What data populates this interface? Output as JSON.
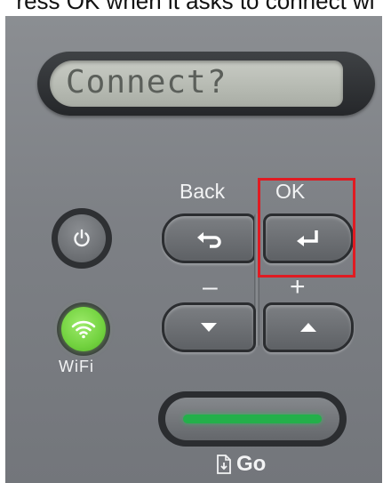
{
  "caption": "ress OK when it asks to connect wi",
  "lcd": {
    "text": "Connect?"
  },
  "labels": {
    "back": "Back",
    "ok": "OK",
    "minus": "–",
    "plus": "+",
    "wifi": "WiFi",
    "go": "Go"
  },
  "icons": {
    "power": "power-icon",
    "back": "back-arrow-icon",
    "ok": "enter-arrow-icon",
    "down": "down-triangle-icon",
    "up": "up-triangle-icon",
    "wifi": "wifi-icon",
    "go": "document-icon"
  },
  "colors": {
    "highlight": "#e01b22",
    "wifi_led": "#72d23f",
    "go_led": "#23b04a"
  }
}
